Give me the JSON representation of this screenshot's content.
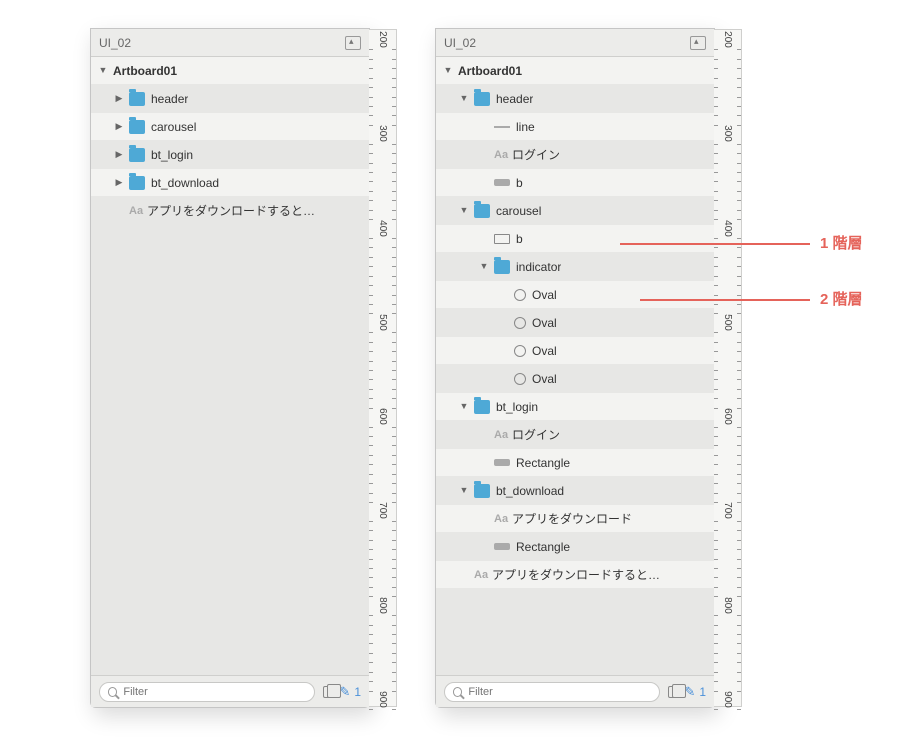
{
  "page_title": "UI_02",
  "filter_placeholder": "Filter",
  "footer_count": "1",
  "ruler_ticks": [
    "200",
    "300",
    "400",
    "500",
    "600",
    "700",
    "800",
    "900"
  ],
  "left": {
    "artboard": "Artboard01",
    "rows": [
      {
        "label": "header"
      },
      {
        "label": "carousel"
      },
      {
        "label": "bt_login"
      },
      {
        "label": "bt_download"
      },
      {
        "label": "アプリをダウンロードすると…"
      }
    ]
  },
  "right": {
    "artboard": "Artboard01",
    "header": {
      "name": "header",
      "children": [
        {
          "label": "line",
          "icon": "line"
        },
        {
          "label": "ログイン",
          "icon": "text"
        },
        {
          "label": "b",
          "icon": "rect-fill"
        }
      ]
    },
    "carousel": {
      "name": "carousel",
      "children": [
        {
          "label": "b",
          "icon": "rect-outline"
        }
      ],
      "indicator": {
        "name": "indicator",
        "children": [
          {
            "label": "Oval"
          },
          {
            "label": "Oval"
          },
          {
            "label": "Oval"
          },
          {
            "label": "Oval"
          }
        ]
      }
    },
    "bt_login": {
      "name": "bt_login",
      "children": [
        {
          "label": "ログイン",
          "icon": "text"
        },
        {
          "label": "Rectangle",
          "icon": "rect-fill"
        }
      ]
    },
    "bt_download": {
      "name": "bt_download",
      "children": [
        {
          "label": "アプリをダウンロード",
          "icon": "text"
        },
        {
          "label": "Rectangle",
          "icon": "rect-fill"
        }
      ]
    },
    "bottom_text": "アプリをダウンロードすると…"
  },
  "annotations": {
    "level1": "1 階層",
    "level2": "2 階層"
  }
}
